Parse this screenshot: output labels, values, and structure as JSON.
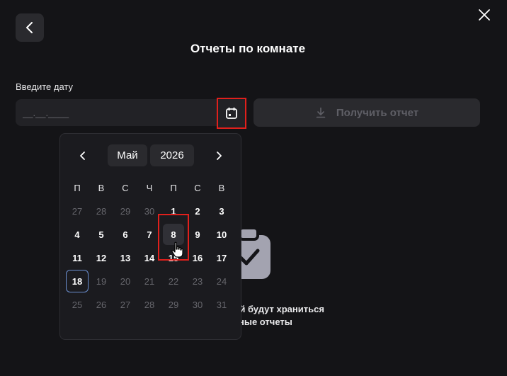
{
  "header": {
    "title": "Отчеты по комнате"
  },
  "date_input": {
    "label": "Введите дату",
    "placeholder": "__.__.____",
    "value": ""
  },
  "report_button": {
    "label": "Получить отчет"
  },
  "icons": {
    "back": "chevron-left-icon",
    "close": "close-icon",
    "calendar": "calendar-icon",
    "download": "download-icon",
    "empty_state": "clipboard-check-icon"
  },
  "empty_state": {
    "line1": "дней будут храниться",
    "line2": "ные отчеты"
  },
  "calendar": {
    "month": "Май",
    "year": "2026",
    "weekdays": [
      "П",
      "В",
      "С",
      "Ч",
      "П",
      "С",
      "В"
    ],
    "weeks": [
      [
        {
          "d": "27",
          "muted": true
        },
        {
          "d": "28",
          "muted": true
        },
        {
          "d": "29",
          "muted": true
        },
        {
          "d": "30",
          "muted": true
        },
        {
          "d": "1"
        },
        {
          "d": "2"
        },
        {
          "d": "3"
        }
      ],
      [
        {
          "d": "4"
        },
        {
          "d": "5"
        },
        {
          "d": "6"
        },
        {
          "d": "7"
        },
        {
          "d": "8",
          "hover": true
        },
        {
          "d": "9"
        },
        {
          "d": "10"
        }
      ],
      [
        {
          "d": "11"
        },
        {
          "d": "12"
        },
        {
          "d": "13"
        },
        {
          "d": "14"
        },
        {
          "d": "15"
        },
        {
          "d": "16"
        },
        {
          "d": "17"
        }
      ],
      [
        {
          "d": "18",
          "today": true
        },
        {
          "d": "19",
          "muted": true
        },
        {
          "d": "20",
          "muted": true
        },
        {
          "d": "21",
          "muted": true
        },
        {
          "d": "22",
          "muted": true
        },
        {
          "d": "23",
          "muted": true
        },
        {
          "d": "24",
          "muted": true
        }
      ],
      [
        {
          "d": "25",
          "muted": true
        },
        {
          "d": "26",
          "muted": true
        },
        {
          "d": "27",
          "muted": true
        },
        {
          "d": "28",
          "muted": true
        },
        {
          "d": "29",
          "muted": true
        },
        {
          "d": "30",
          "muted": true
        },
        {
          "d": "31",
          "muted": true
        }
      ]
    ]
  },
  "colors": {
    "background": "#141417",
    "highlight": "#e0201c",
    "today_border": "#6b8fd0"
  }
}
